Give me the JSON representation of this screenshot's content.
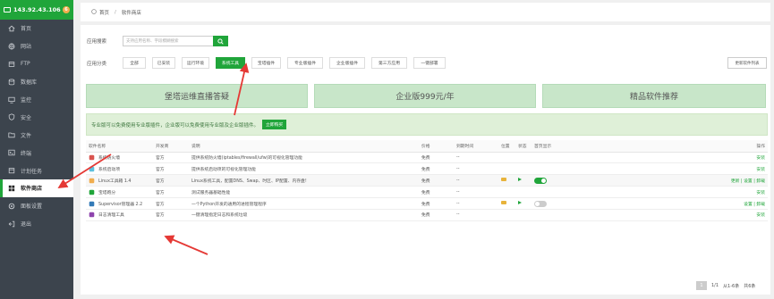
{
  "sidebar": {
    "host": "143.92.43.106",
    "badge": "6",
    "items": [
      {
        "label": "首页",
        "icon": "home-icon"
      },
      {
        "label": "网站",
        "icon": "globe-icon"
      },
      {
        "label": "FTP",
        "icon": "ftp-icon"
      },
      {
        "label": "数据库",
        "icon": "database-icon"
      },
      {
        "label": "监控",
        "icon": "monitor-icon"
      },
      {
        "label": "安全",
        "icon": "shield-icon"
      },
      {
        "label": "文件",
        "icon": "folder-icon"
      },
      {
        "label": "终端",
        "icon": "terminal-icon"
      },
      {
        "label": "计划任务",
        "icon": "calendar-icon"
      },
      {
        "label": "软件商店",
        "icon": "store-icon"
      },
      {
        "label": "面板设置",
        "icon": "settings-icon"
      },
      {
        "label": "退出",
        "icon": "logout-icon"
      }
    ]
  },
  "breadcrumb": {
    "home": "首页",
    "sep": "/",
    "current": "软件商店"
  },
  "search": {
    "label": "应用搜索",
    "placeholder": "支持应用名称、字段模糊搜索"
  },
  "categories": {
    "label": "应用分类",
    "items": [
      "全部",
      "已安装",
      "运行环境",
      "系统工具",
      "宝塔插件",
      "专业版插件",
      "企业版插件",
      "第三方应用",
      "一键部署"
    ],
    "update_label": "更新软件列表"
  },
  "banners": [
    "堡塔运维直播答疑",
    "企业版999元/年",
    "精品软件推荐"
  ],
  "notice": {
    "text": "专业版可以免费使用专业版插件，企业版可以免费使用专业版及企业版插件。",
    "buy": "立即购买"
  },
  "table": {
    "headers": [
      "软件名称",
      "开发商",
      "说明",
      "价格",
      "到期时间",
      "位置",
      "状态",
      "首页显示",
      "操作"
    ],
    "rows": [
      {
        "name": "系统防火墙",
        "icon": "firewall-icon",
        "dev": "官方",
        "desc": "提供系统防火墙(iptables/firewall/ufw)的可视化管理功能",
        "price": "免费",
        "expire": "--",
        "loc": false,
        "status": false,
        "home": "",
        "ops": "安装"
      },
      {
        "name": "系统启动项",
        "icon": "startup-icon",
        "dev": "官方",
        "desc": "提供系统启动项的可视化管理功能",
        "price": "免费",
        "expire": "--",
        "loc": false,
        "status": false,
        "home": "",
        "ops": "安装"
      },
      {
        "name": "Linux工具箱 1.4",
        "icon": "toolbox-icon",
        "dev": "官方",
        "desc": "Linux系统工具，配置DNS、Swap、时区、IP配置、内存盘!",
        "price": "免费",
        "expire": "--",
        "loc": true,
        "status": true,
        "home": "on",
        "ops": "更新 | 设置 | 卸载"
      },
      {
        "name": "宝塔跑分",
        "icon": "benchmark-icon",
        "dev": "官方",
        "desc": "测试服务器基础性能",
        "price": "免费",
        "expire": "--",
        "loc": false,
        "status": false,
        "home": "",
        "ops": "安装"
      },
      {
        "name": "Supervisor管理器 2.2",
        "icon": "supervisor-icon",
        "dev": "官方",
        "desc": "一个Python开发的通用的进程管理程序",
        "price": "免费",
        "expire": "--",
        "loc": true,
        "status": true,
        "home": "off",
        "ops": "设置 | 卸载"
      },
      {
        "name": "日志清理工具",
        "icon": "logclean-icon",
        "dev": "官方",
        "desc": "一键清理指定日志和系统垃圾",
        "price": "免费",
        "expire": "--",
        "loc": false,
        "status": false,
        "home": "",
        "ops": "安装"
      }
    ]
  },
  "pager": {
    "current": "1",
    "pages": "1/1",
    "range": "从1-6条",
    "total": "共6条"
  },
  "colors": {
    "brand": "#20a53a",
    "sidebar": "#3c444d",
    "annotation": "#e53935"
  }
}
